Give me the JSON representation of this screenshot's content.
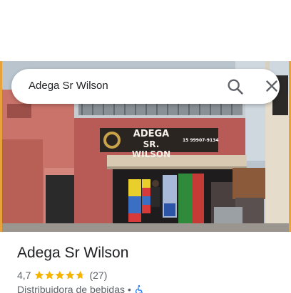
{
  "search": {
    "query": "Adega Sr Wilson",
    "search_icon": "search-icon",
    "close_icon": "close-icon"
  },
  "photo": {
    "sign_line1": "ADEGA",
    "sign_line2": "SR. WILSON",
    "sign_phone": "15 99907-9134"
  },
  "place": {
    "name": "Adega Sr Wilson",
    "rating": "4,7",
    "rating_value": 4.7,
    "review_count": "(27)",
    "category": "Distribuidora de bebidas",
    "separator": "•",
    "accessibility_icon": "wheelchair-icon"
  },
  "colors": {
    "star": "#f4b400",
    "accessible": "#1a73e8",
    "text_primary": "#202124",
    "text_secondary": "#5f6368"
  }
}
